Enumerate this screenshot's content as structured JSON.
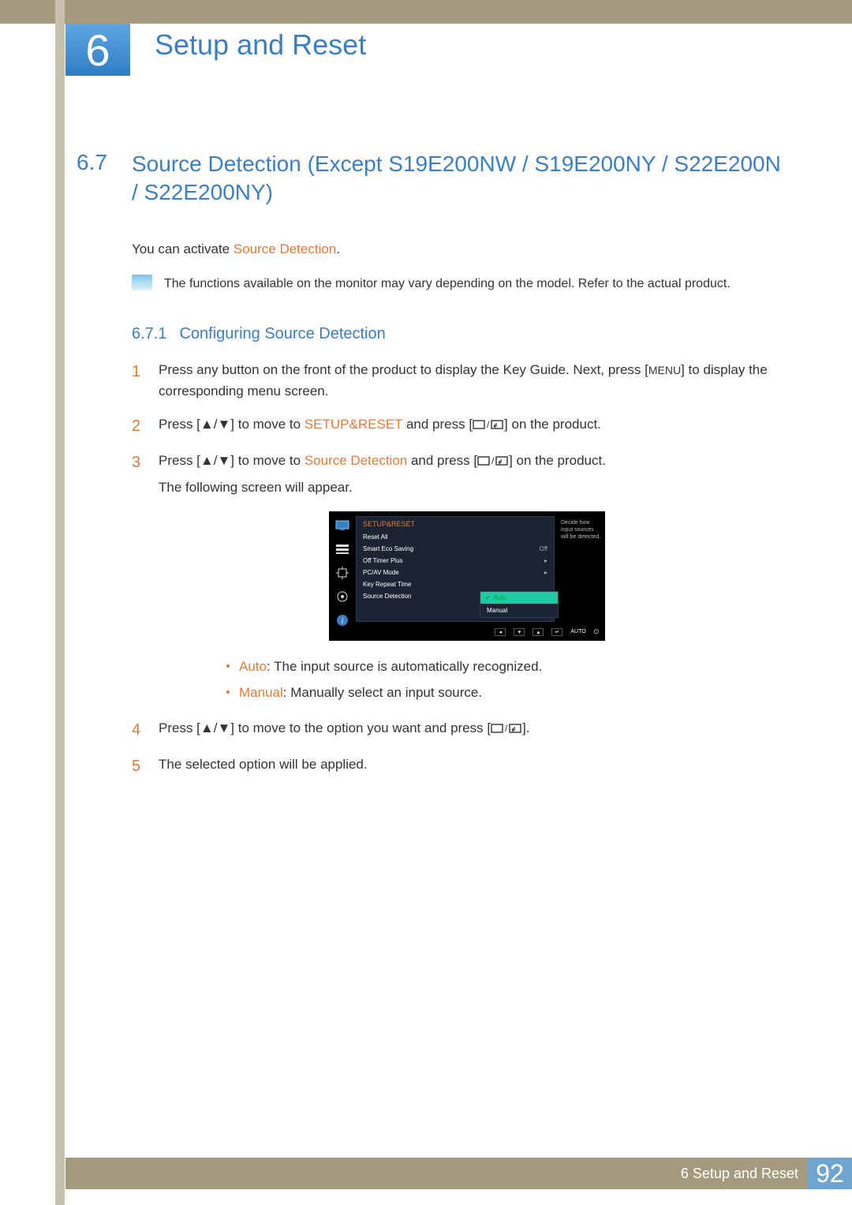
{
  "chapter": {
    "number": "6",
    "title": "Setup and Reset"
  },
  "section": {
    "number": "6.7",
    "title": "Source Detection (Except S19E200NW / S19E200NY / S22E200N / S22E200NY)"
  },
  "intro": {
    "pre": "You can activate ",
    "hl": "Source Detection",
    "post": "."
  },
  "note": "The functions available on the monitor may vary depending on the model. Refer to the actual product.",
  "subsection": {
    "number": "6.7.1",
    "title": "Configuring Source Detection"
  },
  "steps": {
    "s1n": "1",
    "s1a": "Press any button on the front of the product to display the Key Guide. Next, press [",
    "s1menu": "MENU",
    "s1b": "] to display the corresponding menu screen.",
    "s2n": "2",
    "s2a": "Press [",
    "s2b": "] to move to ",
    "s2hl": "SETUP&RESET",
    "s2c": " and press [",
    "s2d": "] on the product.",
    "s3n": "3",
    "s3a": "Press [",
    "s3b": "] to move to ",
    "s3hl": "Source Detection",
    "s3c": " and press [",
    "s3d": "] on the product.",
    "s3e": "The following screen will appear.",
    "s4n": "4",
    "s4a": "Press [",
    "s4b": "] to move to the option you want and press [",
    "s4c": "].",
    "s5n": "5",
    "s5": "The selected option will be applied."
  },
  "osd": {
    "header": "SETUP&RESET",
    "items": [
      {
        "l": "Reset All",
        "r": ""
      },
      {
        "l": "Smart Eco Saving",
        "r": "Off"
      },
      {
        "l": "Off Timer Plus",
        "r": "▸"
      },
      {
        "l": "PC/AV Mode",
        "r": "▸"
      },
      {
        "l": "Key Repeat Time",
        "r": ""
      },
      {
        "l": "Source Detection",
        "r": ""
      }
    ],
    "popup": {
      "hl": "Auto",
      "other": "Manual"
    },
    "help": "Decide how input sources will be detected.",
    "footer_auto": "AUTO"
  },
  "bullets": {
    "b1hl": "Auto",
    "b1": ": The input source is automatically recognized.",
    "b2hl": "Manual",
    "b2": ": Manually select an input source."
  },
  "footer": {
    "text": "6  Setup and Reset",
    "page": "92"
  }
}
